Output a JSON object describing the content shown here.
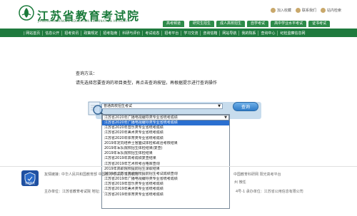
{
  "header": {
    "title": "江苏省教育考试院",
    "subtitle": "JIANGSU PROVINCIAL EDUCATION EXAMINATION AUTHORITY",
    "top_links": [
      {
        "label": "加入收藏",
        "icon": "star-icon"
      },
      {
        "label": "联系我们",
        "icon": "phone-icon"
      },
      {
        "label": "站内检索",
        "icon": "search-icon"
      }
    ],
    "tabs": [
      "高考频道",
      "研究生招生",
      "成人高校招生",
      "自学考试",
      "高中学业水平考试",
      "证书考试"
    ]
  },
  "nav": {
    "items": [
      "| 网站首页",
      "信息公开",
      "招考资讯",
      "政策规定",
      "招考指南",
      "科研与评价",
      "考试动态",
      "招考平台",
      "学习交流",
      "咨询信箱",
      "网站导航",
      "我的院系",
      "查询中心",
      "纪检监察信息网"
    ]
  },
  "main": {
    "howto_title": "查询方法：",
    "howto_text": "请先选择您要查询的项目类型，再点击查询按钮，再根据提示进行查询操作",
    "selected_category": "普通高校招生考试",
    "query_button": "查询",
    "selected_item": "江苏省2020年广播电视编导类专业省统考成绩",
    "options": [
      "江苏省2020年广播电视编导类专业省统考成绩",
      "江苏省2020年音乐类专业省统考成绩",
      "江苏省2020年美术类专业省统考成绩",
      "江苏省2020年体育类专业省统考成绩",
      "2019年定向培养士官面试体检和政治考核结果",
      "2019年军队院校招生体检结果(复查)",
      "2019年军队院校招生体检结果",
      "江苏省2019年高考成绩复查结果",
      "江苏省2019年艺术校考合格库查询",
      "2019年高职院校提前招生录取结果",
      "2019年江苏省高职院校提前招生考试成绩查询",
      "江苏省2019年广播电视编导类专业省统考成绩",
      "江苏省2019年音乐类专业省统考成绩",
      "江苏省2019年美术类专业省统考成绩",
      "江苏省2019年体育类专业省统考成绩"
    ],
    "highlighted_index": 0
  },
  "footer": {
    "links_label": "友情链接：",
    "links_text": "中华人民共和国教育部    中国教育考试网    江苏教育   ...",
    "right_links": "中国教育科研网    阳光高考平台",
    "right_line2": "州    微任",
    "host_text": "主办单位：江苏省教育考试院    地址：...",
    "right_line3": "4号-1    承办单位：江苏省公用信息有限公司",
    "badge_text": "党政机关"
  }
}
